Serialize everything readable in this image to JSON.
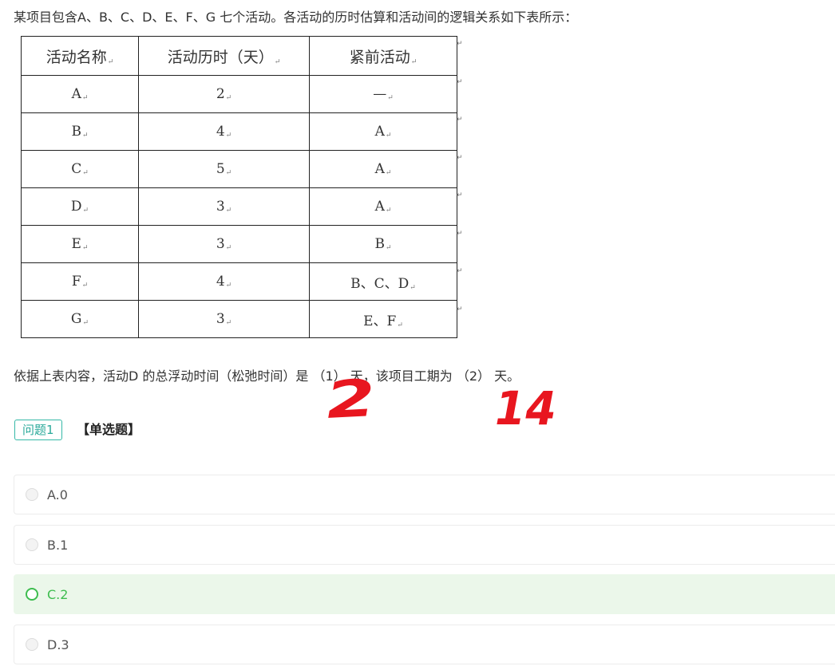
{
  "intro_text": "某项目包含A、B、C、D、E、F、G 七个活动。各活动的历时估算和活动间的逻辑关系如下表所示：",
  "table": {
    "headers": [
      "活动名称",
      "活动历时（天）",
      "紧前活动"
    ],
    "rows": [
      [
        "A",
        "2",
        "—"
      ],
      [
        "B",
        "4",
        "A"
      ],
      [
        "C",
        "5",
        "A"
      ],
      [
        "D",
        "3",
        "A"
      ],
      [
        "E",
        "3",
        "B"
      ],
      [
        "F",
        "4",
        "B、C、D"
      ],
      [
        "G",
        "3",
        "E、F"
      ]
    ],
    "mark": "↵"
  },
  "question_text": "依据上表内容，活动D 的总浮动时间（松弛时间）是 （1） 天，该项目工期为 （2） 天。",
  "handwriting": {
    "answer1": "2",
    "answer2": "14",
    "color": "#e8161f"
  },
  "question_tag": "问题1",
  "question_type": "【单选题】",
  "options": [
    {
      "label": "A.0",
      "selected": false
    },
    {
      "label": "B.1",
      "selected": false
    },
    {
      "label": "C.2",
      "selected": true
    },
    {
      "label": "D.3",
      "selected": false
    }
  ],
  "colors": {
    "accent_green": "#3ebd4f",
    "selected_bg": "#ebf7ea",
    "tag_teal": "#2aa99a"
  }
}
